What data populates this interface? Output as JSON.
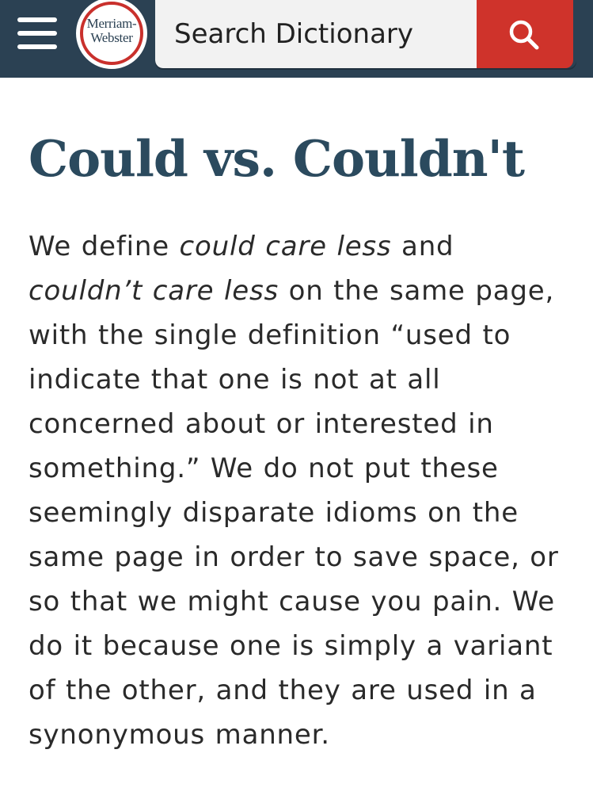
{
  "header": {
    "logo": {
      "line1": "Merriam-",
      "line2": "Webster"
    },
    "search": {
      "placeholder": "Search Dictionary"
    },
    "icons": {
      "menu": "hamburger-menu-icon",
      "search": "search-icon"
    },
    "colors": {
      "header_bg": "#2b4153",
      "search_button": "#cf332b",
      "logo_ring": "#c9302c",
      "title": "#2b4a5e"
    }
  },
  "article": {
    "title": "Could vs. Couldn't",
    "paragraph": {
      "p1": "We define ",
      "em1": "could care less",
      "p2": " and ",
      "em2": "couldn’t care less",
      "p3": " on the same page, with the single definition “used to indicate that one is not at all concerned about or interested in something.” We do not put these seemingly disparate idioms on the same page in order to save space, or so that we might cause you pain. We do it because one is simply a variant of the other, and they are used in a synonymous manner."
    }
  }
}
